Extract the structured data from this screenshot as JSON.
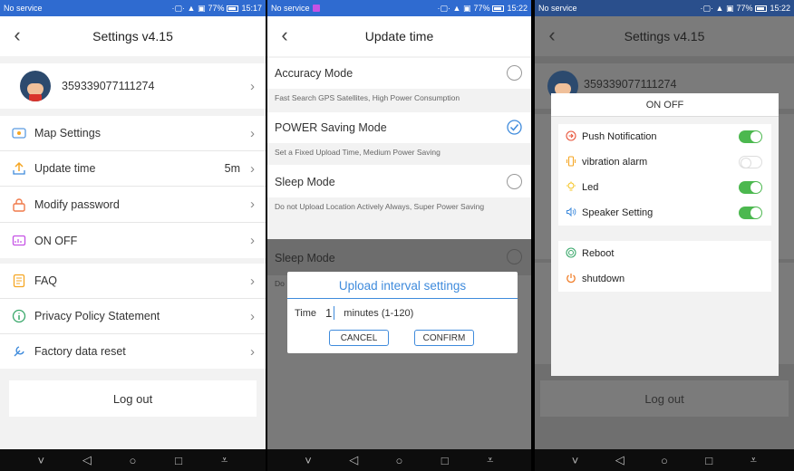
{
  "status": {
    "carrier": "No service",
    "icons": "·▢· ▲ ▣",
    "battery": "77%",
    "time_1": "15:17",
    "time_2": "15:22",
    "time_3": "15:22"
  },
  "colors": {
    "status_bar": "#2f6bd0",
    "accent": "#3f8bdc",
    "toggle_on": "#4cb84f",
    "icon_orange": "#f5a623"
  },
  "settings": {
    "title": "Settings v4.15",
    "device_id": "359339077111274",
    "items": [
      {
        "label": "Map Settings",
        "icon": "map-icon",
        "value": ""
      },
      {
        "label": "Update time",
        "icon": "upload-icon",
        "value": "5m"
      },
      {
        "label": "Modify password",
        "icon": "lock-icon",
        "value": ""
      },
      {
        "label": "ON OFF",
        "icon": "monitor-icon",
        "value": ""
      },
      {
        "label": "FAQ",
        "icon": "faq-icon",
        "value": ""
      },
      {
        "label": "Privacy Policy Statement",
        "icon": "info-icon",
        "value": ""
      },
      {
        "label": "Factory data reset",
        "icon": "reset-icon",
        "value": ""
      }
    ],
    "logout": "Log out"
  },
  "update_time": {
    "title": "Update time",
    "modes": [
      {
        "name": "Accuracy Mode",
        "desc": "Fast Search GPS Satellites, High Power Consumption",
        "selected": false
      },
      {
        "name": "POWER Saving Mode",
        "desc": "Set a Fixed Upload Time, Medium Power Saving",
        "selected": true
      },
      {
        "name": "Sleep Mode",
        "desc": "Do not Upload Location Actively Always, Super Power Saving",
        "selected": false
      }
    ],
    "dimmed_mode": "Sleep Mode",
    "dimmed_desc_prefix": "Do",
    "dialog": {
      "title": "Upload interval settings",
      "label": "Time",
      "value": "1",
      "unit": "minutes (1-120)",
      "cancel": "CANCEL",
      "confirm": "CONFIRM"
    }
  },
  "onoff": {
    "title": "Settings v4.15",
    "device_id": "359339077111274",
    "sheet_title": "ON OFF",
    "toggles": [
      {
        "label": "Push Notification",
        "icon": "notification-icon",
        "on": true
      },
      {
        "label": "vibration alarm",
        "icon": "vibration-icon",
        "on": false
      },
      {
        "label": "Led",
        "icon": "led-icon",
        "on": true
      },
      {
        "label": "Speaker Setting",
        "icon": "speaker-icon",
        "on": true
      }
    ],
    "actions": [
      {
        "label": "Reboot",
        "icon": "reboot-icon"
      },
      {
        "label": "shutdown",
        "icon": "power-icon"
      }
    ],
    "logout": "Log out"
  },
  "nav": {
    "down": "˅",
    "back": "◁",
    "home": "○",
    "recent": "□",
    "menu": "⩡"
  }
}
